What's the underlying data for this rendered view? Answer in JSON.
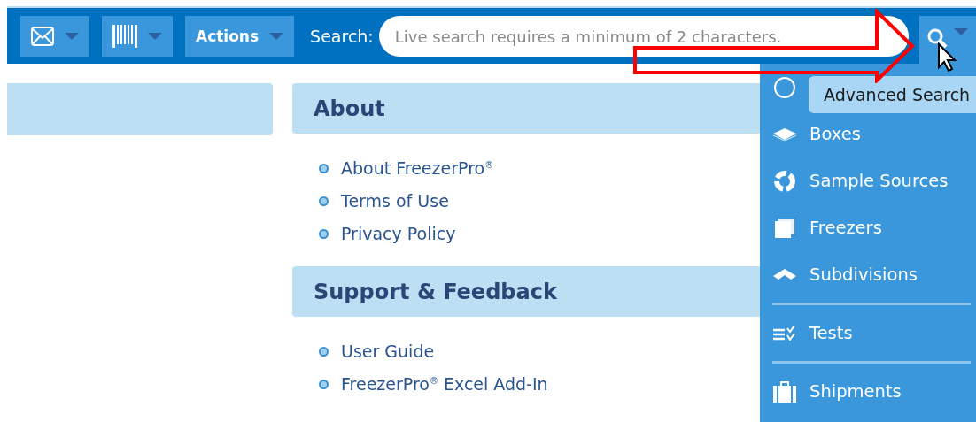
{
  "toolbar": {
    "actions_label": "Actions",
    "search_label": "Search:",
    "search": {
      "placeholder": "Live search requires a minimum of 2 characters."
    }
  },
  "sections": [
    {
      "title": "About",
      "links": [
        "About FreezerPro$^{®}$",
        "Terms of Use",
        "Privacy Policy"
      ]
    },
    {
      "title": "Support & Feedback",
      "links": [
        "User Guide",
        "FreezerPro$^{®}$ Excel Add-In"
      ]
    }
  ],
  "search_menu": {
    "tooltip": "Advanced Search",
    "items": [
      {
        "kind": "item"
      },
      {
        "kind": "item",
        "label": "Boxes"
      },
      {
        "kind": "item",
        "label": "Sample Sources"
      },
      {
        "kind": "item",
        "label": "Freezers"
      },
      {
        "kind": "item",
        "label": "Subdivisions"
      },
      {
        "kind": "divider"
      },
      {
        "kind": "item",
        "label": "Tests"
      },
      {
        "kind": "divider"
      },
      {
        "kind": "item",
        "label": "Shipments"
      }
    ]
  }
}
